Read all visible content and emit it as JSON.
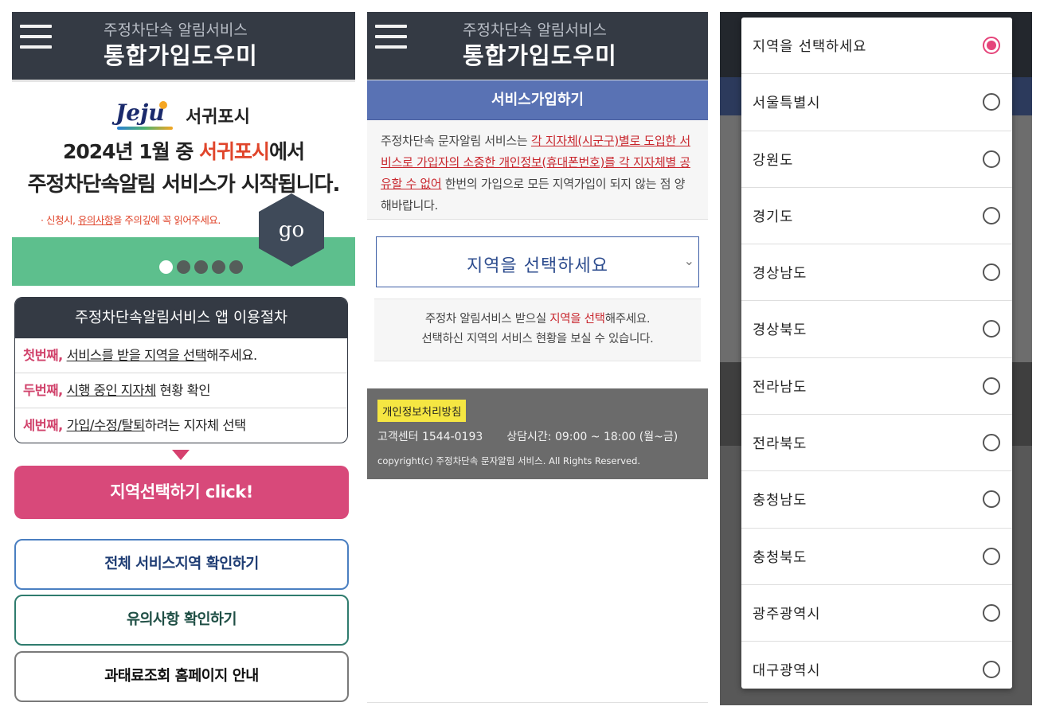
{
  "screen1": {
    "header": {
      "subtitle": "주정차단속 알림서비스",
      "title": "통합가입도우미"
    },
    "banner": {
      "logo_word": "Jeju",
      "logo_city": "서귀포시",
      "line1_pre": "2024년 1월 중 ",
      "line1_highlight": "서귀포시",
      "line1_post": "에서",
      "line2": "주정차단속알림 서비스가 시작됩니다.",
      "note_pre": "· 신청시, ",
      "note_link": "유의사항",
      "note_post": "을 주의깊에 꼭 읽어주세요.",
      "go_label": "go",
      "slides_total": 5,
      "slide_active": 1
    },
    "steps": {
      "title": "주정차단속알림서비스 앱 이용절차",
      "rows": [
        {
          "num": "첫번째,",
          "link": "서비스를 받을 지역을 선택",
          "rest": "해주세요."
        },
        {
          "num": "두번째,",
          "link": "시행 중인 지자체",
          "rest": " 현황 확인"
        },
        {
          "num": "세번째,",
          "link": "가입/수정/탈퇴",
          "rest": "하려는 지자체 선택"
        }
      ]
    },
    "buttons": {
      "region_select": "지역선택하기 click!",
      "all_regions": "전체 서비스지역 확인하기",
      "notice": "유의사항 확인하기",
      "fine_lookup": "과태료조회 홈페이지 안내"
    },
    "colors": {
      "header": "#343a44",
      "accent_pink": "#d8497a",
      "banner_green": "#5dbf8d",
      "highlight_red": "#e0452b"
    }
  },
  "screen2": {
    "header": {
      "subtitle": "주정차단속 알림서비스",
      "title": "통합가입도우미"
    },
    "section_title": "서비스가입하기",
    "intro": {
      "pre": "주정차단속 문자알림 서비스는 ",
      "red": "각 지자체(시군구)별로 도입한 서비스로 가입자의 소중한 개인정보(휴대폰번호)를 각 지자체별 공유할 수 없어",
      "post": " 한번의 가입으로 모든 지역가입이 되지 않는 점 양해바랍니다."
    },
    "region_select": {
      "placeholder": "지역을 선택하세요"
    },
    "hint": {
      "pre": "주정차 알림서비스 받으실 ",
      "red": "지역을 선택",
      "post": "해주세요.",
      "line2": "선택하신 지역의 서비스 현황을 보실 수 있습니다."
    },
    "footer": {
      "privacy": "개인정보처리방침",
      "callcenter": "고객센터 1544-0193",
      "hours": "상담시간: 09:00 ~ 18:00 (월~금)",
      "copyright": "copyright(c) 주정차단속 문자알림 서비스. All Rights Reserved."
    },
    "colors": {
      "section_bar": "#5972b4",
      "footer": "#6b6b6b",
      "badge": "#f5e642"
    }
  },
  "screen3": {
    "dialog": {
      "options": [
        {
          "label": "지역을 선택하세요",
          "selected": true
        },
        {
          "label": "서울특별시",
          "selected": false
        },
        {
          "label": "강원도",
          "selected": false
        },
        {
          "label": "경기도",
          "selected": false
        },
        {
          "label": "경상남도",
          "selected": false
        },
        {
          "label": "경상북도",
          "selected": false
        },
        {
          "label": "전라남도",
          "selected": false
        },
        {
          "label": "전라북도",
          "selected": false
        },
        {
          "label": "충청남도",
          "selected": false
        },
        {
          "label": "충청북도",
          "selected": false
        },
        {
          "label": "광주광역시",
          "selected": false
        },
        {
          "label": "대구광역시",
          "selected": false
        }
      ]
    },
    "colors": {
      "radio_selected": "#e5447a"
    }
  }
}
